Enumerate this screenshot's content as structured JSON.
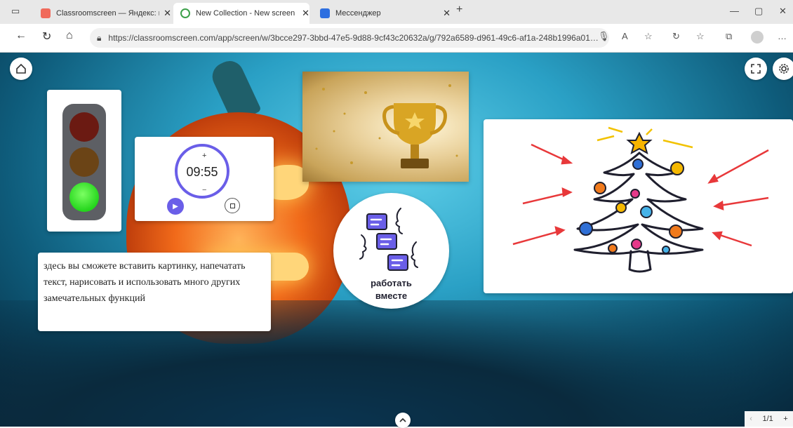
{
  "browser": {
    "tabs": [
      {
        "title": "Classroomscreen — Яндекс: най…",
        "close": "✕"
      },
      {
        "title": "New Collection - New screen",
        "close": "✕"
      },
      {
        "title": "Мессенджер",
        "close": "✕"
      }
    ],
    "new_tab": "+",
    "window_controls": {
      "minimize": "—",
      "restore": "▢",
      "close": "✕"
    },
    "url": "https://classroomscreen.com/app/screen/w/3bcce297-3bbd-47e5-9d88-9cf43c20632a/g/792a6589-d961-49c6-af1a-248b1996a01…",
    "nav": {
      "back": "←",
      "reload": "↻",
      "home": "⌂"
    },
    "tools": {
      "reader": "A",
      "more": "…"
    },
    "accent": "#6a5ee8"
  },
  "screen": {
    "home_icon": "home-icon",
    "fullscreen_icon": "fullscreen-icon",
    "settings_icon": "gear-icon",
    "traffic_light": {
      "active": "green"
    },
    "timer": {
      "plus": "+",
      "time": "09:55",
      "minus": "−"
    },
    "text_widget": "здесь вы сможете вставить картинку, напечатать текст, нарисовать и использовать много других замечательных функций",
    "work_together": {
      "line1": "работать",
      "line2": "вместе"
    },
    "collapse_icon": "chevron-up-icon",
    "pager": {
      "prev": "‹",
      "page": "1/1",
      "add": "+"
    }
  }
}
